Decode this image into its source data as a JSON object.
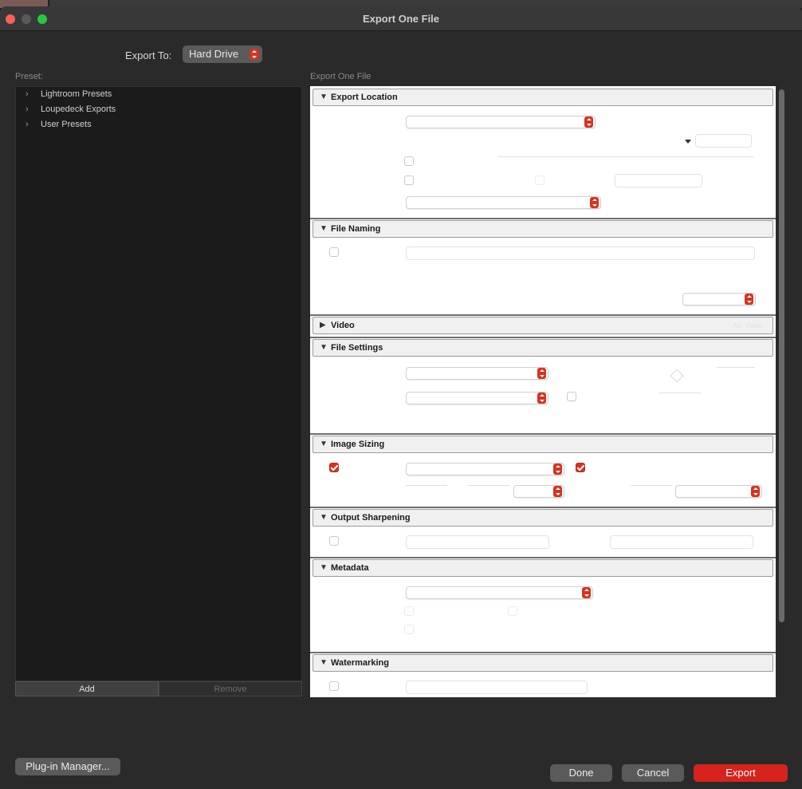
{
  "window": {
    "title": "Export One File"
  },
  "export_to": {
    "label": "Export To:",
    "value": "Hard Drive"
  },
  "presets": {
    "label": "Preset:",
    "items": [
      {
        "label": "Lightroom Presets"
      },
      {
        "label": "Loupedeck Exports"
      },
      {
        "label": "User Presets"
      }
    ],
    "add_label": "Add",
    "remove_label": "Remove"
  },
  "settings": {
    "label": "Export One File",
    "sections": {
      "export_location": {
        "name": "Export Location",
        "expanded": true
      },
      "file_naming": {
        "name": "File Naming",
        "expanded": true
      },
      "video": {
        "name": "Video",
        "expanded": false,
        "extra": "No Video"
      },
      "file_settings": {
        "name": "File Settings",
        "expanded": true
      },
      "image_sizing": {
        "name": "Image Sizing",
        "expanded": true
      },
      "output_sharpening": {
        "name": "Output Sharpening",
        "expanded": true
      },
      "metadata": {
        "name": "Metadata",
        "expanded": true
      },
      "watermarking": {
        "name": "Watermarking",
        "expanded": true
      }
    },
    "image_sizing_resize_checked": true,
    "image_sizing_enlarge_checked": true
  },
  "footer": {
    "plugin_manager_label": "Plug-in Manager...",
    "done_label": "Done",
    "cancel_label": "Cancel",
    "export_label": "Export"
  },
  "colors": {
    "accent": "#d6231b",
    "background": "#2a2a2a"
  },
  "icons": {
    "tree_collapsed": "chevron-right-icon",
    "section_expanded": "triangle-down-icon",
    "section_collapsed": "triangle-right-icon",
    "stepper": "select-stepper-icon"
  }
}
